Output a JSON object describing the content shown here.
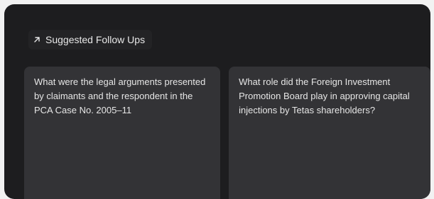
{
  "header": {
    "icon": "arrow-up-right-icon",
    "title": "Suggested Follow Ups"
  },
  "suggestions": [
    {
      "text": "What were the legal arguments presented by claimants and the respondent in the PCA Case No. 2005–11"
    },
    {
      "text": "What role did the Foreign Investment Promotion Board play in approving capital injections by Tetas shareholders?"
    }
  ],
  "colors": {
    "panel_bg": "#1d1d1f",
    "card_bg": "#333336",
    "text": "#e6e6e6"
  }
}
